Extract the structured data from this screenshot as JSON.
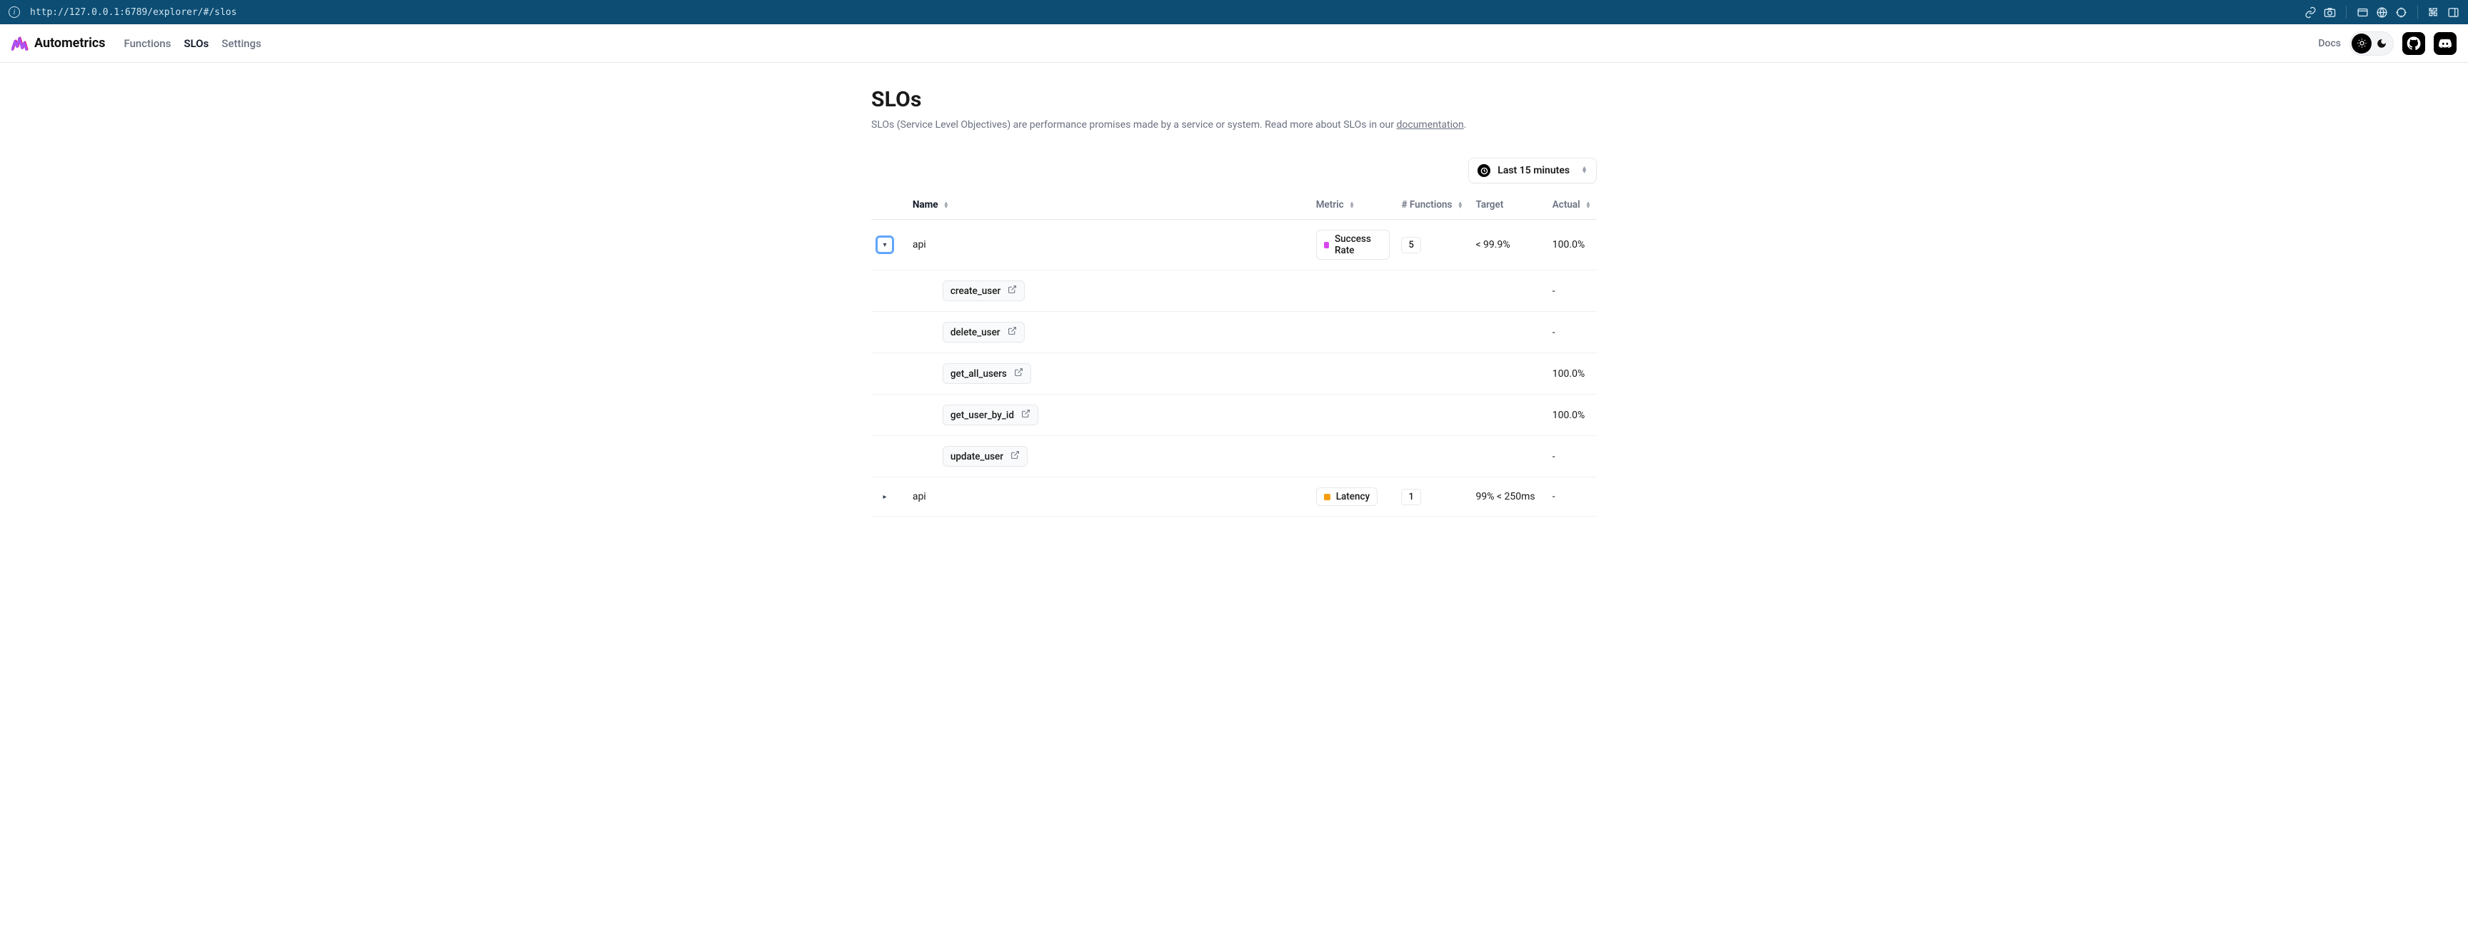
{
  "browser": {
    "url": "http://127.0.0.1:6789/explorer/#/slos"
  },
  "header": {
    "brand": "Autometrics",
    "nav": {
      "functions": "Functions",
      "slos": "SLOs",
      "settings": "Settings"
    },
    "docs": "Docs"
  },
  "page": {
    "title": "SLOs",
    "subtitle_prefix": "SLOs (Service Level Objectives) are performance promises made by a service or system. Read more about SLOs in our ",
    "subtitle_link": "documentation",
    "subtitle_suffix": "."
  },
  "time_picker": {
    "label": "Last 15 minutes"
  },
  "table": {
    "headers": {
      "name": "Name",
      "metric": "Metric",
      "functions": "# Functions",
      "target": "Target",
      "actual": "Actual"
    },
    "rows": [
      {
        "expand_glyph": "▾",
        "expand_focused": true,
        "name": "api",
        "metric_label": "Success Rate",
        "metric_color": "#d946ef",
        "count": "5",
        "target": "< 99.9%",
        "actual": "100.0%"
      }
    ],
    "children": [
      {
        "name": "create_user",
        "actual": "-"
      },
      {
        "name": "delete_user",
        "actual": "-"
      },
      {
        "name": "get_all_users",
        "actual": "100.0%"
      },
      {
        "name": "get_user_by_id",
        "actual": "100.0%"
      },
      {
        "name": "update_user",
        "actual": "-"
      }
    ],
    "rows2": [
      {
        "expand_glyph": "▸",
        "expand_focused": false,
        "name": "api",
        "metric_label": "Latency",
        "metric_color": "#f59e0b",
        "count": "1",
        "target": "99% < 250ms",
        "actual": "-"
      }
    ]
  }
}
